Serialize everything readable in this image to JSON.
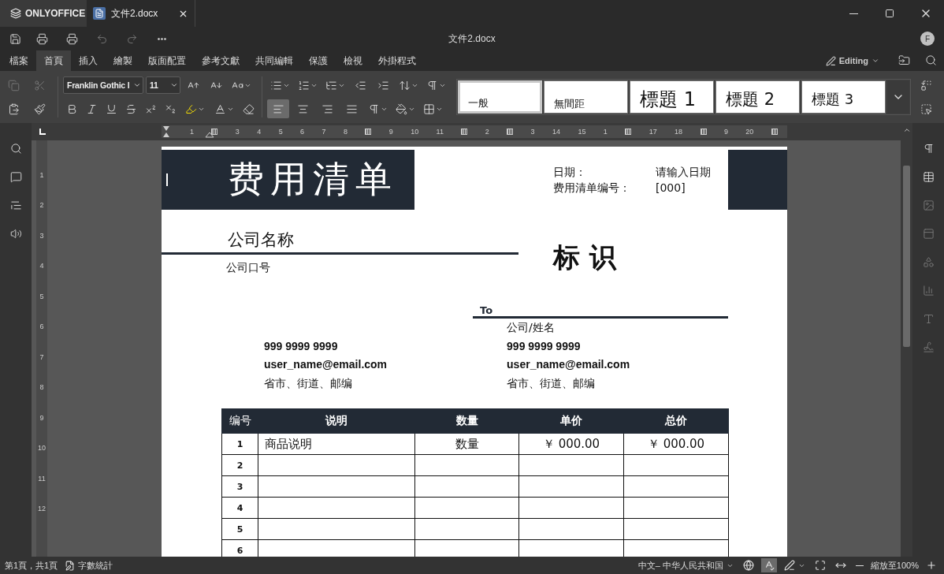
{
  "app": {
    "brand": "ONLYOFFICE"
  },
  "tabs": [
    {
      "title": "文件2.docx"
    }
  ],
  "window": {
    "title": "文件2.docx",
    "avatar": "F"
  },
  "menu": [
    {
      "label": "檔案",
      "selected": false
    },
    {
      "label": "首頁",
      "selected": true
    },
    {
      "label": "插入",
      "selected": false
    },
    {
      "label": "繪製",
      "selected": false
    },
    {
      "label": "版面配置",
      "selected": false
    },
    {
      "label": "參考文獻",
      "selected": false
    },
    {
      "label": "共同編輯",
      "selected": false
    },
    {
      "label": "保護",
      "selected": false
    },
    {
      "label": "檢視",
      "selected": false
    },
    {
      "label": "外掛程式",
      "selected": false
    }
  ],
  "mode": {
    "label": "Editing"
  },
  "toolbar": {
    "font": "Franklin Gothic I",
    "size": "11",
    "alignments": [
      {
        "kind": "left",
        "selected": true
      },
      {
        "kind": "center",
        "selected": false
      },
      {
        "kind": "right",
        "selected": false
      },
      {
        "kind": "justify",
        "selected": false
      }
    ],
    "styles": [
      {
        "label": "一般",
        "kind": "normal",
        "selected": true
      },
      {
        "label": "無間距",
        "kind": "normal",
        "selected": false
      },
      {
        "label": "標題 1",
        "kind": "heading1",
        "selected": false
      },
      {
        "label": "標題 2",
        "kind": "heading2",
        "selected": false
      },
      {
        "label": "標題 3",
        "kind": "heading3",
        "selected": false
      }
    ]
  },
  "ruler": {
    "horizontal": [
      {
        "kind": "number",
        "label": "1"
      },
      {
        "kind": "marker"
      },
      {
        "kind": "number",
        "label": "3"
      },
      {
        "kind": "number",
        "label": "4"
      },
      {
        "kind": "number",
        "label": "5"
      },
      {
        "kind": "number",
        "label": "6"
      },
      {
        "kind": "number",
        "label": "7"
      },
      {
        "kind": "number",
        "label": "8"
      },
      {
        "kind": "marker"
      },
      {
        "kind": "number",
        "label": "9"
      },
      {
        "kind": "number",
        "label": "10"
      },
      {
        "kind": "number",
        "label": "11"
      },
      {
        "kind": "marker"
      },
      {
        "kind": "number",
        "label": "2"
      },
      {
        "kind": "marker"
      },
      {
        "kind": "number",
        "label": "3"
      },
      {
        "kind": "number",
        "label": "14"
      },
      {
        "kind": "number",
        "label": "15"
      },
      {
        "kind": "number",
        "label": "1"
      },
      {
        "kind": "marker"
      },
      {
        "kind": "number",
        "label": "17"
      },
      {
        "kind": "number",
        "label": "18"
      },
      {
        "kind": "marker"
      },
      {
        "kind": "number",
        "label": "9"
      },
      {
        "kind": "number",
        "label": "20"
      },
      {
        "kind": "marker"
      }
    ],
    "vertical": [
      "1",
      "2",
      "3",
      "4",
      "5",
      "6",
      "7",
      "8",
      "9",
      "10",
      "11",
      "12"
    ]
  },
  "document": {
    "header": {
      "title": "费用清单",
      "fields": [
        {
          "label": "日期：",
          "value": "请输入日期"
        },
        {
          "label": "费用清单编号：",
          "value": "[000]"
        }
      ]
    },
    "company": {
      "name": "公司名称",
      "slogan": "公司口号",
      "logo": "标 识"
    },
    "bill_to": {
      "label": "To",
      "name": "公司/姓名"
    },
    "sender_contact": [
      {
        "kind": "phone",
        "text": "999 9999 9999"
      },
      {
        "kind": "email",
        "text": "user_name@email.com"
      },
      {
        "kind": "address",
        "text": "省市、街道、邮编"
      }
    ],
    "recipient_contact": [
      {
        "kind": "phone",
        "text": "999 9999 9999"
      },
      {
        "kind": "email",
        "text": "user_name@email.com"
      },
      {
        "kind": "address",
        "text": "省市、街道、邮编"
      }
    ],
    "table": {
      "columns": [
        "编号",
        "说明",
        "数量",
        "单价",
        "总价"
      ],
      "rows": [
        {
          "cells": [
            "1",
            "商品说明",
            "数量",
            "￥ 000.00",
            "￥ 000.00"
          ]
        },
        {
          "cells": [
            "2"
          ]
        },
        {
          "cells": [
            "3"
          ]
        },
        {
          "cells": [
            "4"
          ]
        },
        {
          "cells": [
            "5"
          ]
        },
        {
          "cells": [
            "6"
          ]
        }
      ]
    }
  },
  "status_bar": {
    "page": "第1頁，共1頁",
    "word_count": "字數統計",
    "language": "中文– 中华人民共和国",
    "spellcheck": true,
    "zoom": "縮放至100%"
  }
}
